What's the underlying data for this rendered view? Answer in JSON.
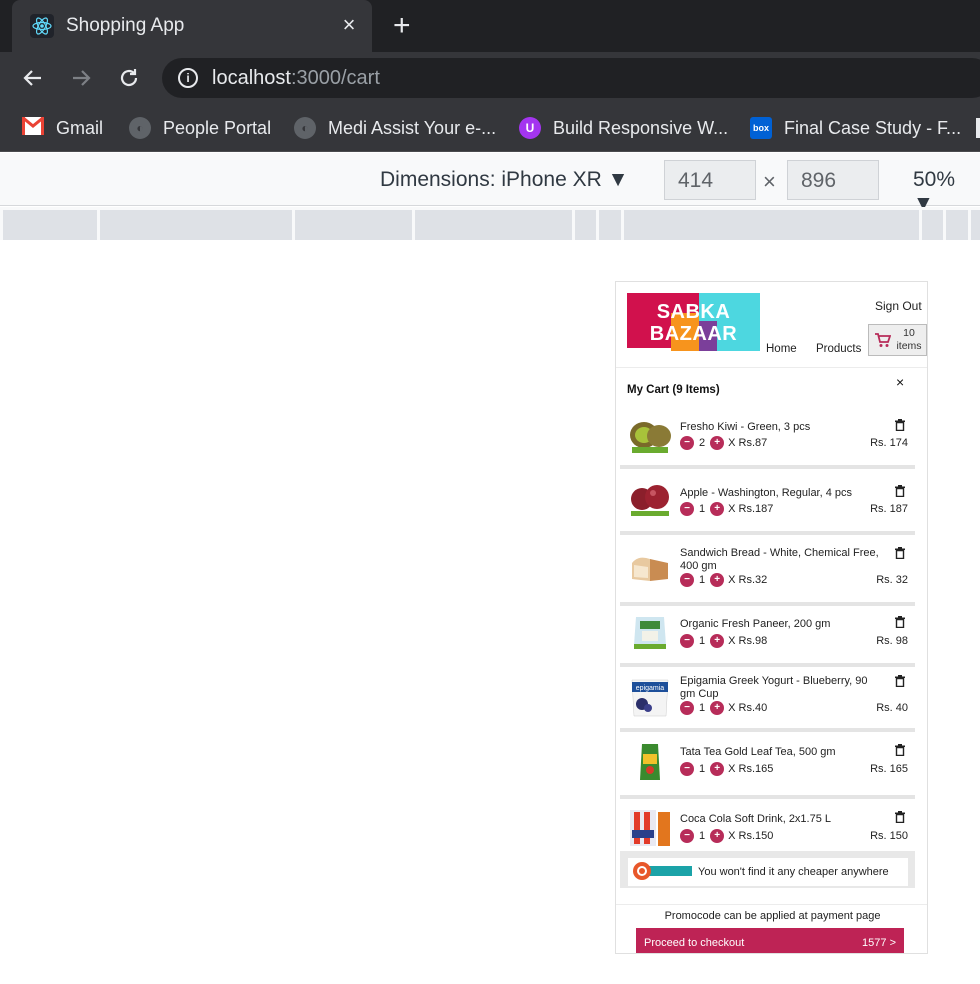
{
  "browser": {
    "tab_title": "Shopping App",
    "tab_close": "×",
    "new_tab": "+",
    "url_host": "localhost",
    "url_path": ":3000/cart",
    "bookmarks": [
      {
        "label": "Gmail",
        "icon": "gmail-icon"
      },
      {
        "label": "People Portal",
        "icon": "globe-icon"
      },
      {
        "label": "Medi Assist Your e-...",
        "icon": "globe-icon"
      },
      {
        "label": "Build Responsive W...",
        "icon": "udemy-icon"
      },
      {
        "label": "Final Case Study - F...",
        "icon": "box-icon"
      }
    ]
  },
  "devtools": {
    "dimensions_label": "Dimensions: iPhone XR ▼",
    "width": "414",
    "height": "896",
    "times": "×",
    "zoom": "50% ▼"
  },
  "app": {
    "logo_line1": "SABKA",
    "logo_line2": "BAZAAR",
    "sign_out": "Sign Out",
    "nav_home": "Home",
    "nav_products": "Products",
    "cart_count": "10",
    "cart_items_label": "items",
    "cart_title": "My Cart (9 Items)",
    "close": "×",
    "items": [
      {
        "name": "Fresho Kiwi - Green, 3 pcs",
        "qty": "2",
        "price": "X Rs.87",
        "total": "Rs. 174"
      },
      {
        "name": "Apple - Washington, Regular, 4 pcs",
        "qty": "1",
        "price": "X Rs.187",
        "total": "Rs. 187"
      },
      {
        "name": "Sandwich Bread - White, Chemical Free, 400 gm",
        "qty": "1",
        "price": "X Rs.32",
        "total": "Rs. 32"
      },
      {
        "name": "Organic Fresh Paneer, 200 gm",
        "qty": "1",
        "price": "X Rs.98",
        "total": "Rs. 98"
      },
      {
        "name": "Epigamia Greek Yogurt - Blueberry, 90 gm Cup",
        "qty": "1",
        "price": "X Rs.40",
        "total": "Rs. 40"
      },
      {
        "name": "Tata Tea Gold Leaf Tea, 500 gm",
        "qty": "1",
        "price": "X Rs.165",
        "total": "Rs. 165"
      },
      {
        "name": "Coca Cola Soft Drink, 2x1.75 L",
        "qty": "1",
        "price": "X Rs.150",
        "total": "Rs. 150"
      }
    ],
    "promo_text": "You won't find it any cheaper anywhere",
    "promo_note": "Promocode can be applied at payment page",
    "checkout_label": "Proceed to checkout",
    "checkout_amount": "1577 >"
  }
}
